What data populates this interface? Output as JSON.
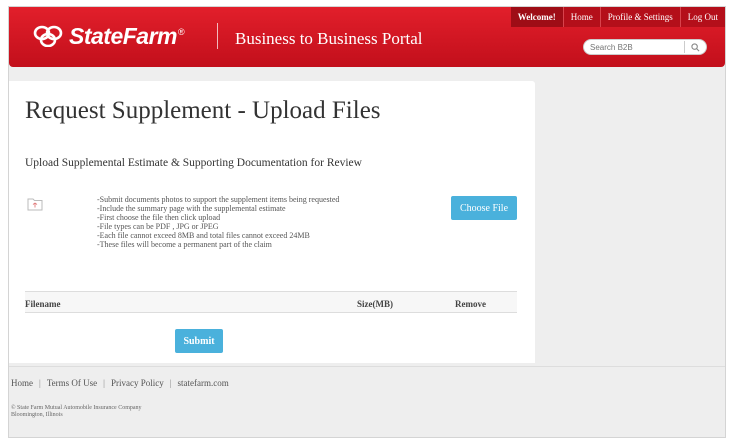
{
  "header": {
    "brand_name": "StateFarm",
    "brand_reg": "®",
    "portal_title": "Business to Business Portal",
    "nav": {
      "welcome": "Welcome!",
      "home": "Home",
      "profile": "Profile & Settings",
      "logout": "Log Out"
    },
    "search_placeholder": "Search B2B"
  },
  "page": {
    "title": "Request Supplement - Upload Files",
    "subtitle": "Upload Supplemental Estimate & Supporting Documentation for Review",
    "instructions": [
      "-Submit documents photos to support the supplement items being requested",
      "-Include the summary page with the supplemental estimate",
      "-First choose the file then click upload",
      "-File types can be PDF , JPG or JPEG",
      "-Each file cannot exceed 8MB and total files cannot exceed 24MB",
      "-These files will become a permanent part of the claim"
    ],
    "choose_file_label": "Choose File",
    "table": {
      "col_filename": "Filename",
      "col_size": "Size(MB)",
      "col_remove": "Remove"
    },
    "submit_label": "Submit"
  },
  "footer": {
    "links": [
      "Home",
      "Terms Of Use",
      "Privacy Policy",
      "statefarm.com"
    ],
    "separator": "|",
    "copyright_line1": "© State Farm Mutual Automobile Insurance Company",
    "copyright_line2": "Bloomington, Illinois"
  },
  "colors": {
    "header_red": "#d4151f",
    "button_blue": "#4ab1dc"
  }
}
